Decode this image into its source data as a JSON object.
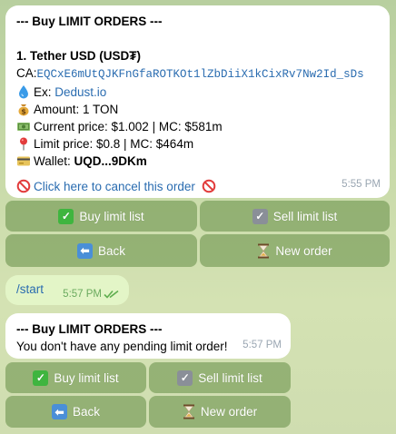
{
  "message1": {
    "header": "--- Buy LIMIT ORDERS ---",
    "item_title": "1. Tether USD (USD₮)",
    "ca_label": "CA:",
    "ca_value": "EQCxE6mUtQJKFnGfaROTKOt1lZbDiiX1kCixRv7Nw2Id_sDs",
    "ex_label": "Ex: ",
    "ex_value": "Dedust.io",
    "amount": "Amount: 1 TON",
    "current_price": "Current price: $1.002 | MC: $581m",
    "limit_price": "Limit price: $0.8 | MC: $464m",
    "wallet_label": "Wallet: ",
    "wallet_value": "UQD...9DKm",
    "cancel_link": "Click here to cancel this order",
    "time": "5:55 PM"
  },
  "keyboard1": {
    "buy_list": "Buy limit list",
    "sell_list": "Sell limit list",
    "back": "Back",
    "new_order": "New order"
  },
  "outgoing": {
    "command": "/start",
    "time": "5:57 PM"
  },
  "message2": {
    "header": "--- Buy LIMIT ORDERS ---",
    "body": "You don't have any pending limit order!",
    "time": "5:57 PM"
  },
  "keyboard2": {
    "buy_list": "Buy limit list",
    "sell_list": "Sell limit list",
    "back": "Back",
    "new_order": "New order"
  },
  "colors": {
    "link": "#2a6cb0",
    "keyboard_button": "#7c9d5f",
    "outgoing_bubble": "#e3f5c7"
  }
}
